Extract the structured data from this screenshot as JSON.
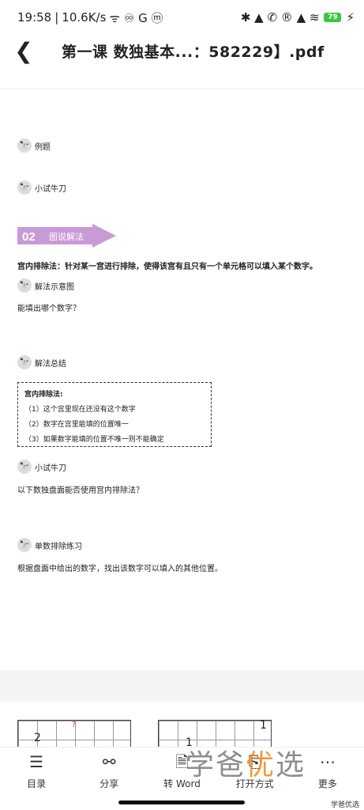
{
  "status": {
    "time": "19:58",
    "speed": "10.6K/s",
    "extra": "ᯤ ♾ G ⓜ",
    "right_icons": "✱ ▲ ✆ ® ▲ ≋",
    "battery": "79",
    "charging": "⚡"
  },
  "header": {
    "back_icon": "back-icon",
    "title": "第一课 数独基本...：582229】.pdf"
  },
  "doc": {
    "item_example": "例题",
    "item_trial1": "小试牛刀",
    "banner_num": "02",
    "banner_text": "图说解法",
    "rule": "宫内排除法：针对某一宫进行排除，使得该宫有且只有一个单元格可以填入某个数字。",
    "diagram": "解法示意图",
    "question1": "能填出哪个数字？",
    "summary": "解法总结",
    "box_title": "宫内排除法:",
    "box_lines": [
      "（1）这个宫里现在还没有这个数字",
      "（2）数字在宫里能填的位置唯一",
      "（3）如果数字能填的位置不唯一则不能确定"
    ],
    "trial2": "小试牛刀",
    "question2": "以下数独盘面能否使用宫内排除法？",
    "practice": "单数排除练习",
    "practice_desc": "根据盘面中给出的数字，找出该数字可以填入的其他位置。"
  },
  "grid1": {
    "num_a": "2",
    "num_b": "?"
  },
  "grid2": {
    "num_a": "1",
    "num_b": "1"
  },
  "toolbar": {
    "toc": "目录",
    "share": "分享",
    "word": "转 Word",
    "open": "打开方式",
    "more": "更多"
  },
  "watermark": {
    "a": "学爸",
    "b": "优",
    "c": "选",
    "small": "学爸优选"
  },
  "colors": {
    "banner": "#c89ad6",
    "banner_text": "#ffffff",
    "battery": "#3ec53e"
  }
}
